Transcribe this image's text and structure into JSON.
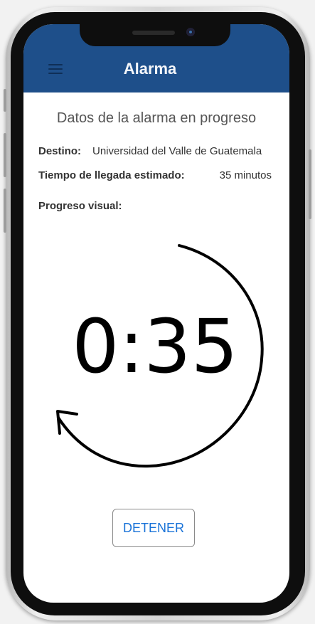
{
  "app": {
    "title": "Alarma",
    "menu_icon": "hamburger-menu-icon"
  },
  "section": {
    "title": "Datos de la alarma en progreso"
  },
  "details": {
    "destination_label": "Destino:",
    "destination_value": "Universidad del Valle de Guatemala",
    "eta_label": "Tiempo de llegada estimado:",
    "eta_value": "35 minutos",
    "progress_label": "Progreso visual:"
  },
  "timer": {
    "display": "0:35",
    "icon": "countdown-arrow-icon"
  },
  "actions": {
    "stop_label": "DETENER"
  },
  "colors": {
    "header": "#1e4f8a",
    "button_text": "#1a73d8"
  }
}
